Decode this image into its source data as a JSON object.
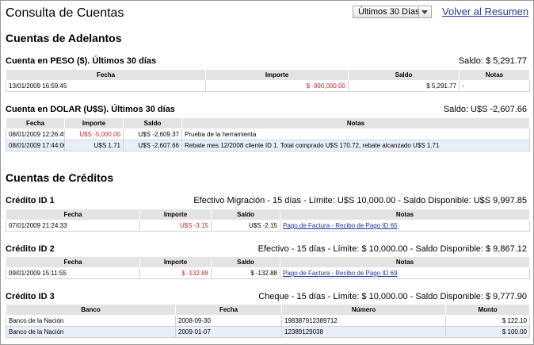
{
  "header": {
    "title": "Consulta de Cuentas",
    "period_select": "Últimos 30 Días",
    "back_link": "Volver al Resumen"
  },
  "advances": {
    "title": "Cuentas de Adelantos",
    "peso": {
      "title": "Cuenta en PESO ($). Últimos 30 días",
      "balance": "Saldo: $ 5,291.77",
      "columns": [
        "Fecha",
        "Importe",
        "Saldo",
        "Notas"
      ],
      "rows": [
        {
          "fecha": "13/01/2009 16:59:45",
          "importe": "$ -990,000.00",
          "saldo": "$ 5,291.77",
          "notas": "-"
        }
      ]
    },
    "dolar": {
      "title": "Cuenta en DOLAR (U$S). Últimos 30 días",
      "balance": "Saldo: U$S -2,607.66",
      "columns": [
        "Fecha",
        "Importe",
        "Saldo",
        "Notas"
      ],
      "rows": [
        {
          "fecha": "08/01/2009 12:26:45",
          "importe": "U$S -5,000.00",
          "saldo": "U$S -2,609.37",
          "notas": "Prueba de la herramienta"
        },
        {
          "fecha": "08/01/2009 17:44:00",
          "importe": "U$S 1.71",
          "saldo": "U$S -2,607.66",
          "notas": "Rebate mes 12/2008 cliente ID 1. Total comprado U$S 170.72, rebate alcanzado U$S 1.71"
        }
      ]
    }
  },
  "credits": {
    "title": "Cuentas de Créditos",
    "credit1": {
      "title": "Crédito ID 1",
      "info": "Efectivo Migración - 15 días - Límite: U$S 10,000.00 - Saldo Disponible: U$S 9,997.85",
      "columns": [
        "Fecha",
        "Importe",
        "Saldo",
        "Notas"
      ],
      "rows": [
        {
          "fecha": "07/01/2009 21:24:33",
          "importe": "U$S -3.15",
          "saldo": "U$S -2.15",
          "notas": "Pago de Factura - Recibo de Pago ID 65"
        }
      ]
    },
    "credit2": {
      "title": "Crédito ID 2",
      "info": "Efectivo - 15 días - Límite: $ 10,000.00 - Saldo Disponible: $ 9,867.12",
      "columns": [
        "Fecha",
        "Importe",
        "Saldo",
        "Notas"
      ],
      "rows": [
        {
          "fecha": "09/01/2009 15:11:55",
          "importe": "$ -132.88",
          "saldo": "$ -132.88",
          "notas": "Pago de Factura - Recibo de Pago ID 69"
        }
      ]
    },
    "credit3": {
      "title": "Crédito ID 3",
      "info": "Cheque - 15 días - Límite: $ 10,000.00 - Saldo Disponible: $ 9,777.90",
      "columns": [
        "Banco",
        "Fecha",
        "Número",
        "Monto"
      ],
      "rows": [
        {
          "banco": "Banco de la Nación",
          "fecha": "2008-09-30",
          "numero": "198387912389712",
          "monto": "$ 122.10"
        },
        {
          "banco": "Banco de la Nación",
          "fecha": "2009-01-07",
          "numero": "12389129038",
          "monto": "$ 100.00"
        }
      ]
    }
  },
  "colors": {
    "negative": "#c1272d",
    "link": "#1a2fa0",
    "header_bg": "#e3e3e3",
    "alt_row_bg": "#e8effa"
  }
}
